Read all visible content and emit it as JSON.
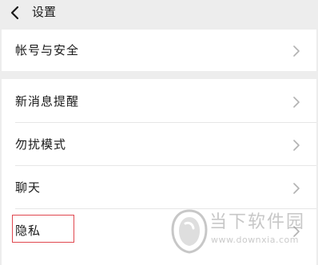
{
  "header": {
    "title": "设置",
    "back_icon": "chevron-left-icon"
  },
  "groups": [
    {
      "items": [
        {
          "label": "帐号与安全",
          "icon": "chevron-right-icon"
        }
      ]
    },
    {
      "items": [
        {
          "label": "新消息提醒",
          "icon": "chevron-right-icon"
        },
        {
          "label": "勿扰模式",
          "icon": "chevron-right-icon"
        },
        {
          "label": "聊天",
          "icon": "chevron-right-icon"
        },
        {
          "label": "隐私",
          "icon": "chevron-right-icon"
        }
      ]
    }
  ],
  "highlight": {
    "target": "隐私",
    "color": "#e0474f"
  },
  "watermark": {
    "name": "当下软件园",
    "url": "www.downxia.com"
  },
  "colors": {
    "background": "#ededed",
    "card": "#ffffff",
    "text": "#1a1a1a",
    "chevron": "#b2b2b2"
  }
}
